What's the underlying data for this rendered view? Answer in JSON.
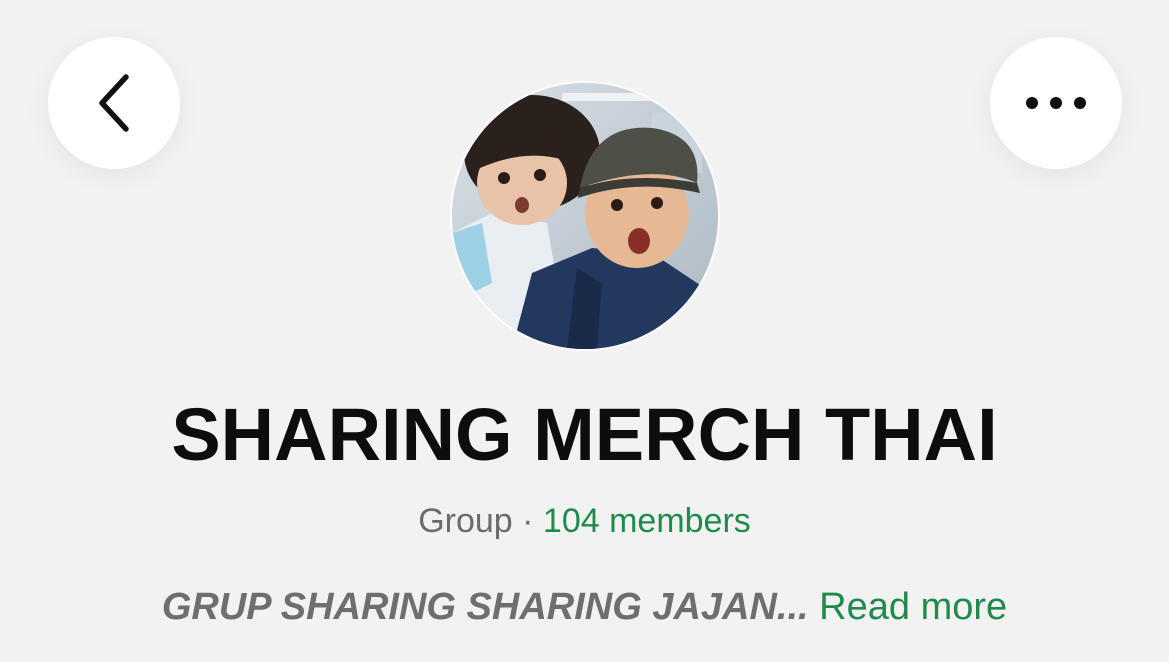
{
  "header": {
    "back_icon": "chevron-left-icon",
    "more_icon": "ellipsis-horizontal-icon"
  },
  "profile": {
    "avatar_alt": "group-avatar-photo",
    "name": "SHARING MERCH THAI",
    "type": "Group",
    "separator": " · ",
    "members": "104 members",
    "description": "GRUP SHARING SHARING JAJAN...",
    "read_more": "Read more"
  },
  "colors": {
    "background": "#f2f2f2",
    "accent_green": "#1f8a4c",
    "text_primary": "#0d0d0d",
    "text_secondary": "#6b6b6b"
  }
}
